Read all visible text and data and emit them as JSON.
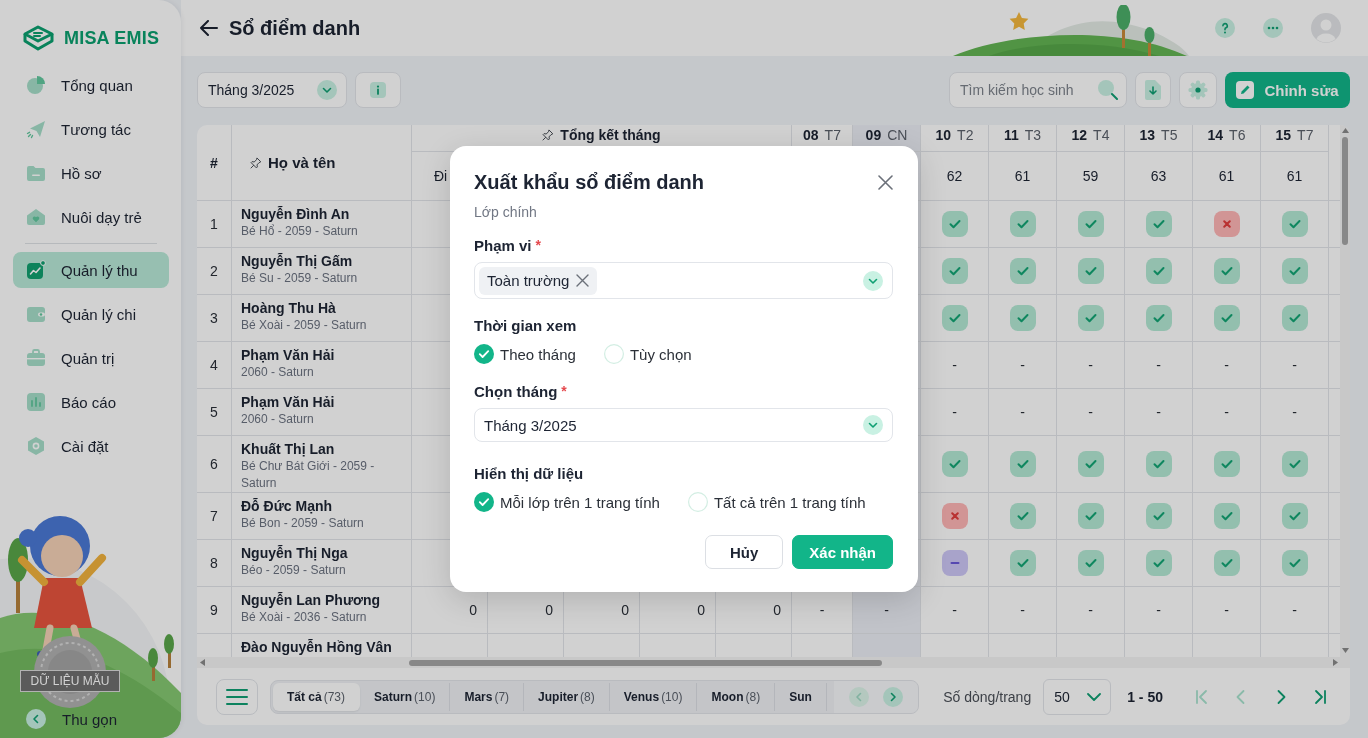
{
  "sidebar": {
    "logo": "MISA EMIS",
    "groups": [
      {
        "items": [
          {
            "label": "Tổng quan",
            "selected": false
          },
          {
            "label": "Tương tác",
            "selected": false
          },
          {
            "label": "Hồ sơ",
            "selected": false
          },
          {
            "label": "Nuôi dạy trẻ",
            "selected": false
          }
        ]
      },
      {
        "items": [
          {
            "label": "Quản lý thu",
            "selected": true
          },
          {
            "label": "Quản lý chi",
            "selected": false
          },
          {
            "label": "Quản trị",
            "selected": false
          },
          {
            "label": "Báo cáo",
            "selected": false
          },
          {
            "label": "Cài đặt",
            "selected": false
          }
        ]
      }
    ],
    "sample_badge": "DỮ LIỆU MẪU",
    "collapse": "Thu gọn"
  },
  "header": {
    "title": "Sổ điểm danh"
  },
  "toolbar": {
    "month": "Tháng 3/2025",
    "search": {
      "placeholder": "Tìm kiếm học sinh"
    },
    "edit_button": "Chỉnh sửa"
  },
  "table": {
    "columns": {
      "index": "#",
      "name": "Họ và tên",
      "summary": "Tổng kết tháng",
      "summary_columns": [
        "Đi"
      ]
    },
    "days": [
      {
        "day": "08",
        "weekday": "T7",
        "weekend": false
      },
      {
        "day": "09",
        "weekday": "CN",
        "weekend": true
      },
      {
        "day": "10",
        "weekday": "T2",
        "weekend": false,
        "count": "62"
      },
      {
        "day": "11",
        "weekday": "T3",
        "weekend": false,
        "count": "61"
      },
      {
        "day": "12",
        "weekday": "T4",
        "weekend": false,
        "count": "59"
      },
      {
        "day": "13",
        "weekday": "T5",
        "weekend": false,
        "count": "63"
      },
      {
        "day": "14",
        "weekday": "T6",
        "weekend": false,
        "count": "61"
      },
      {
        "day": "15",
        "weekday": "T7",
        "weekend": false,
        "count": "61"
      }
    ],
    "rows": [
      {
        "index": "1",
        "name": "Nguyễn Đình An",
        "detail": "Bé Hổ - 2059 - Saturn",
        "days": [
          {
            "kind": "present"
          },
          {
            "kind": "present"
          },
          {
            "kind": "present"
          },
          {
            "kind": "present"
          },
          {
            "kind": "absent"
          },
          {
            "kind": "present"
          }
        ]
      },
      {
        "index": "2",
        "name": "Nguyễn Thị Gấm",
        "detail": "Bé Su - 2059 - Saturn",
        "days": [
          {
            "kind": "present"
          },
          {
            "kind": "present"
          },
          {
            "kind": "present"
          },
          {
            "kind": "present"
          },
          {
            "kind": "present"
          },
          {
            "kind": "present"
          }
        ]
      },
      {
        "index": "3",
        "name": "Hoàng Thu Hà",
        "detail": "Bé Xoài - 2059 - Saturn",
        "days": [
          {
            "kind": "present"
          },
          {
            "kind": "present"
          },
          {
            "kind": "present"
          },
          {
            "kind": "present"
          },
          {
            "kind": "present"
          },
          {
            "kind": "present"
          }
        ]
      },
      {
        "index": "4",
        "name": "Phạm Văn Hải",
        "detail": "2060 - Saturn",
        "days": [
          {
            "kind": "text",
            "text": "-"
          },
          {
            "kind": "text",
            "text": "-"
          },
          {
            "kind": "text",
            "text": "-"
          },
          {
            "kind": "text",
            "text": "-"
          },
          {
            "kind": "text",
            "text": "-"
          },
          {
            "kind": "text",
            "text": "-"
          }
        ]
      },
      {
        "index": "5",
        "name": "Phạm Văn Hải",
        "detail": "2060 - Saturn",
        "days": [
          {
            "kind": "text",
            "text": "-"
          },
          {
            "kind": "text",
            "text": "-"
          },
          {
            "kind": "text",
            "text": "-"
          },
          {
            "kind": "text",
            "text": "-"
          },
          {
            "kind": "text",
            "text": "-"
          },
          {
            "kind": "text",
            "text": "-"
          }
        ]
      },
      {
        "index": "6",
        "name": "Khuất Thị Lan",
        "detail": "Bé Chư Bát Giới - 2059 - Saturn",
        "days": [
          {
            "kind": "present"
          },
          {
            "kind": "present"
          },
          {
            "kind": "present"
          },
          {
            "kind": "present"
          },
          {
            "kind": "present"
          },
          {
            "kind": "present"
          }
        ]
      },
      {
        "index": "7",
        "name": "Đỗ Đức Mạnh",
        "detail": "Bé Bon - 2059 - Saturn",
        "days": [
          {
            "kind": "absent"
          },
          {
            "kind": "present"
          },
          {
            "kind": "present"
          },
          {
            "kind": "present"
          },
          {
            "kind": "present"
          },
          {
            "kind": "present"
          }
        ]
      },
      {
        "index": "8",
        "name": "Nguyễn Thị Nga",
        "detail": "Béo - 2059 - Saturn",
        "days": [
          {
            "kind": "excused"
          },
          {
            "kind": "present"
          },
          {
            "kind": "present"
          },
          {
            "kind": "present"
          },
          {
            "kind": "present"
          },
          {
            "kind": "present"
          }
        ]
      },
      {
        "index": "9",
        "name": "Nguyễn Lan Phương",
        "detail": "Bé Xoài - 2036 - Saturn",
        "summary": [
          "0",
          "0",
          "0",
          "0",
          "0"
        ],
        "days": [
          {
            "kind": "text",
            "text": "-"
          },
          {
            "kind": "text",
            "text": "-"
          },
          {
            "kind": "text",
            "text": "-"
          },
          {
            "kind": "text",
            "text": "-"
          },
          {
            "kind": "text",
            "text": "-"
          },
          {
            "kind": "text",
            "text": "-"
          },
          {
            "kind": "text",
            "text": "-"
          },
          {
            "kind": "text",
            "text": "-"
          }
        ]
      },
      {
        "name": "Đào Nguyễn Hồng Vân"
      }
    ]
  },
  "footer": {
    "class_tabs": [
      {
        "label": "Tất cả",
        "count": "(73)",
        "selected": true
      },
      {
        "label": "Saturn",
        "count": "(10)",
        "selected": false
      },
      {
        "label": "Mars",
        "count": "(7)",
        "selected": false
      },
      {
        "label": "Jupiter",
        "count": "(8)",
        "selected": false
      },
      {
        "label": "Venus",
        "count": "(10)",
        "selected": false
      },
      {
        "label": "Moon",
        "count": "(8)",
        "selected": false
      },
      {
        "label": "Sun",
        "selected": false
      }
    ],
    "tab_scroll": [
      {
        "kind": "prev",
        "disabled": true
      },
      {
        "kind": "next",
        "disabled": false
      }
    ],
    "rows_per_page": {
      "label": "Số dòng/trang",
      "value": "50"
    },
    "range": "1 - 50",
    "pager": [
      {
        "kind": "first",
        "disabled": true
      },
      {
        "kind": "prev",
        "disabled": true
      },
      {
        "kind": "next",
        "disabled": false
      },
      {
        "kind": "last",
        "disabled": false
      }
    ]
  },
  "dialog": {
    "title": "Xuất khẩu sổ điểm danh",
    "subtitle": "Lớp chính",
    "fields": [
      {
        "kind": "tags",
        "label": "Phạm vi",
        "required_mark": "*",
        "tags": [
          "Toàn trường"
        ]
      },
      {
        "kind": "radio",
        "label": "Thời gian xem",
        "options": [
          {
            "label": "Theo tháng",
            "selected": true
          },
          {
            "label": "Tùy chọn",
            "selected": false
          }
        ]
      },
      {
        "kind": "select",
        "label": "Chọn tháng",
        "required_mark": "*",
        "value": "Tháng 3/2025"
      },
      {
        "kind": "radio",
        "label": "Hiển thị dữ liệu",
        "options": [
          {
            "label": "Mỗi lớp trên 1 trang tính",
            "selected": true
          },
          {
            "label": "Tất cả trên 1 trang tính",
            "selected": false
          }
        ]
      }
    ],
    "buttons": [
      {
        "kind": "secondary",
        "label": "Hủy"
      },
      {
        "kind": "primary",
        "label": "Xác nhận"
      }
    ]
  }
}
